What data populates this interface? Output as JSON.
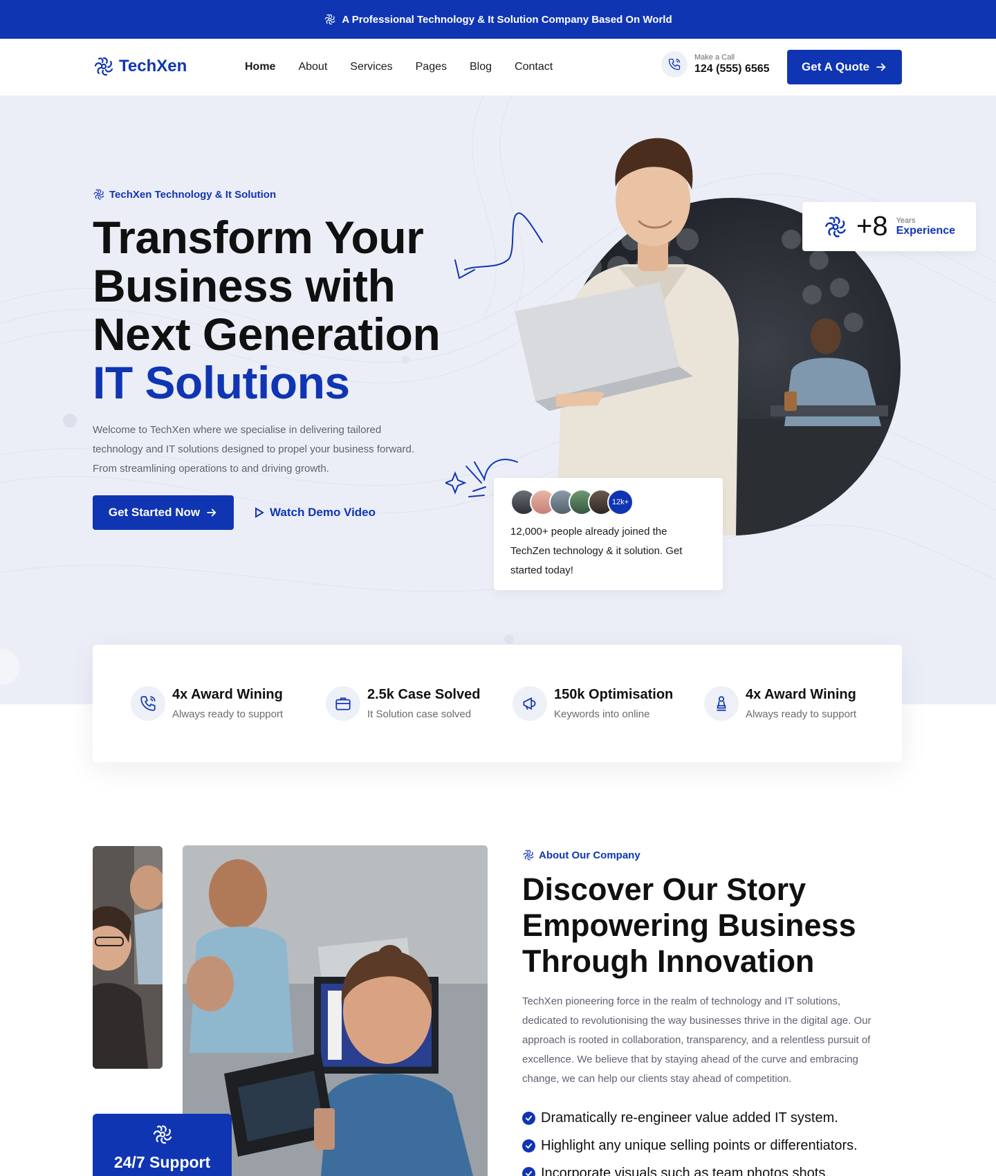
{
  "topbar": {
    "text": "A Professional Technology & It Solution Company Based On World",
    "icon": "swirl-logo-icon"
  },
  "nav": {
    "logo": "TechXen",
    "items": [
      {
        "label": "Home",
        "active": true
      },
      {
        "label": "About"
      },
      {
        "label": "Services"
      },
      {
        "label": "Pages"
      },
      {
        "label": "Blog"
      },
      {
        "label": "Contact"
      }
    ],
    "call_label": "Make a Call",
    "call_number": "124 (555) 6565",
    "quote_button": "Get A Quote"
  },
  "hero": {
    "tagline": "TechXen Technology & It Solution",
    "headline_lines": [
      "Transform Your",
      "Business with",
      "Next Generation"
    ],
    "headline_accent": "IT Solutions",
    "description": "Welcome to TechXen where we specialise in delivering tailored technology and IT solutions designed to propel your business forward. From streamlining operations to and driving growth.",
    "cta_primary": "Get Started Now",
    "cta_secondary": "Watch Demo Video",
    "experience": {
      "value": "+8",
      "unit": "Years",
      "label": "Experience"
    },
    "joined": {
      "badge": "12k+",
      "text": "12,000+ people already joined the TechZen technology & it solution. Get started today!"
    }
  },
  "stats": [
    {
      "title": "4x Award Wining",
      "subtitle": "Always ready to support",
      "icon": "phone-icon"
    },
    {
      "title": "2.5k Case Solved",
      "subtitle": "It Solution case solved",
      "icon": "briefcase-icon"
    },
    {
      "title": "150k Optimisation",
      "subtitle": "Keywords into online",
      "icon": "megaphone-icon"
    },
    {
      "title": "4x Award Wining",
      "subtitle": "Always ready to support",
      "icon": "award-icon"
    }
  ],
  "about": {
    "tag": "About Our Company",
    "title_lines": [
      "Discover Our Story",
      "Empowering Business",
      "Through Innovation"
    ],
    "description": "TechXen pioneering force in the realm of technology and IT solutions, dedicated to revolutionising the way businesses thrive in the digital age. Our approach is rooted in collaboration, transparency, and a relentless pursuit of excellence. We believe that by staying ahead of the curve and embracing change, we can help our clients stay ahead of  competition.",
    "points": [
      "Dramatically re-engineer value added IT system.",
      "Highlight any unique selling points or differentiators.",
      "Incorporate visuals such as team photos shots."
    ],
    "support_label": "24/7 Support"
  },
  "colors": {
    "brand": "#0f35b3",
    "hero_bg": "#eceef7",
    "text_muted": "#5e6172"
  }
}
